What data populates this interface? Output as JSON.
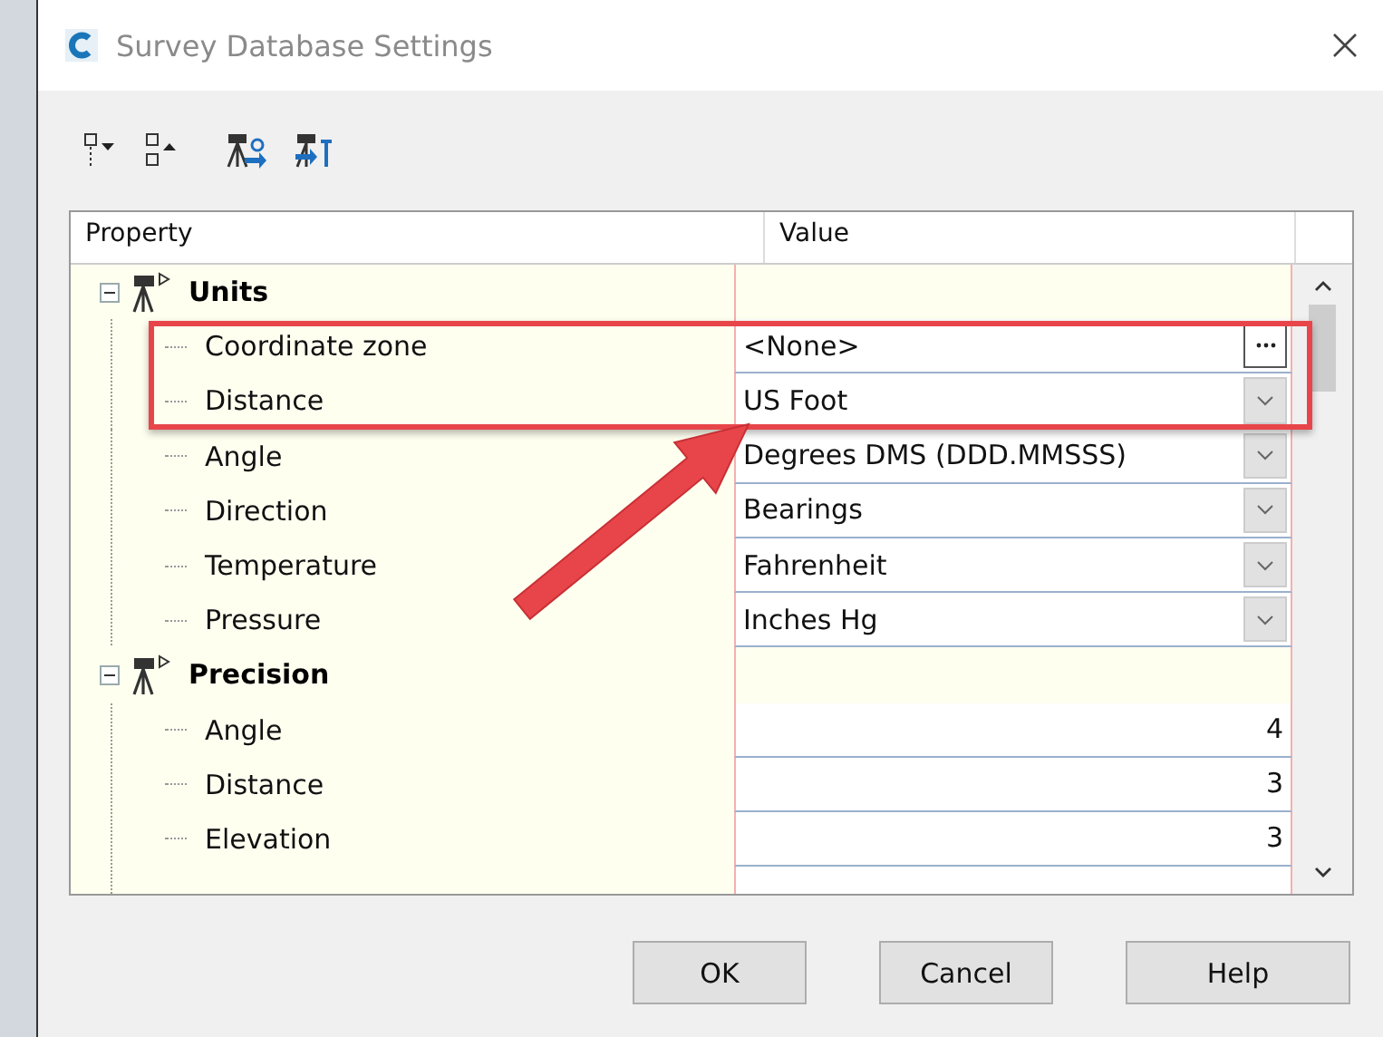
{
  "window": {
    "title": "Survey Database Settings"
  },
  "table": {
    "columns": [
      "Property",
      "Value"
    ],
    "groups": [
      {
        "label": "Units",
        "expanded": true,
        "children": [
          {
            "label": "Coordinate zone",
            "value": "<None>",
            "kind": "ellipsis"
          },
          {
            "label": "Distance",
            "value": "US Foot",
            "kind": "dropdown"
          },
          {
            "label": "Angle",
            "value": "Degrees DMS (DDD.MMSSS)",
            "kind": "dropdown"
          },
          {
            "label": "Direction",
            "value": "Bearings",
            "kind": "dropdown"
          },
          {
            "label": "Temperature",
            "value": "Fahrenheit",
            "kind": "dropdown"
          },
          {
            "label": "Pressure",
            "value": "Inches Hg",
            "kind": "dropdown"
          }
        ]
      },
      {
        "label": "Precision",
        "expanded": true,
        "children": [
          {
            "label": "Angle",
            "value": "4",
            "kind": "number"
          },
          {
            "label": "Distance",
            "value": "3",
            "kind": "number"
          },
          {
            "label": "Elevation",
            "value": "3",
            "kind": "number"
          }
        ]
      }
    ]
  },
  "buttons": [
    "OK",
    "Cancel",
    "Help"
  ]
}
